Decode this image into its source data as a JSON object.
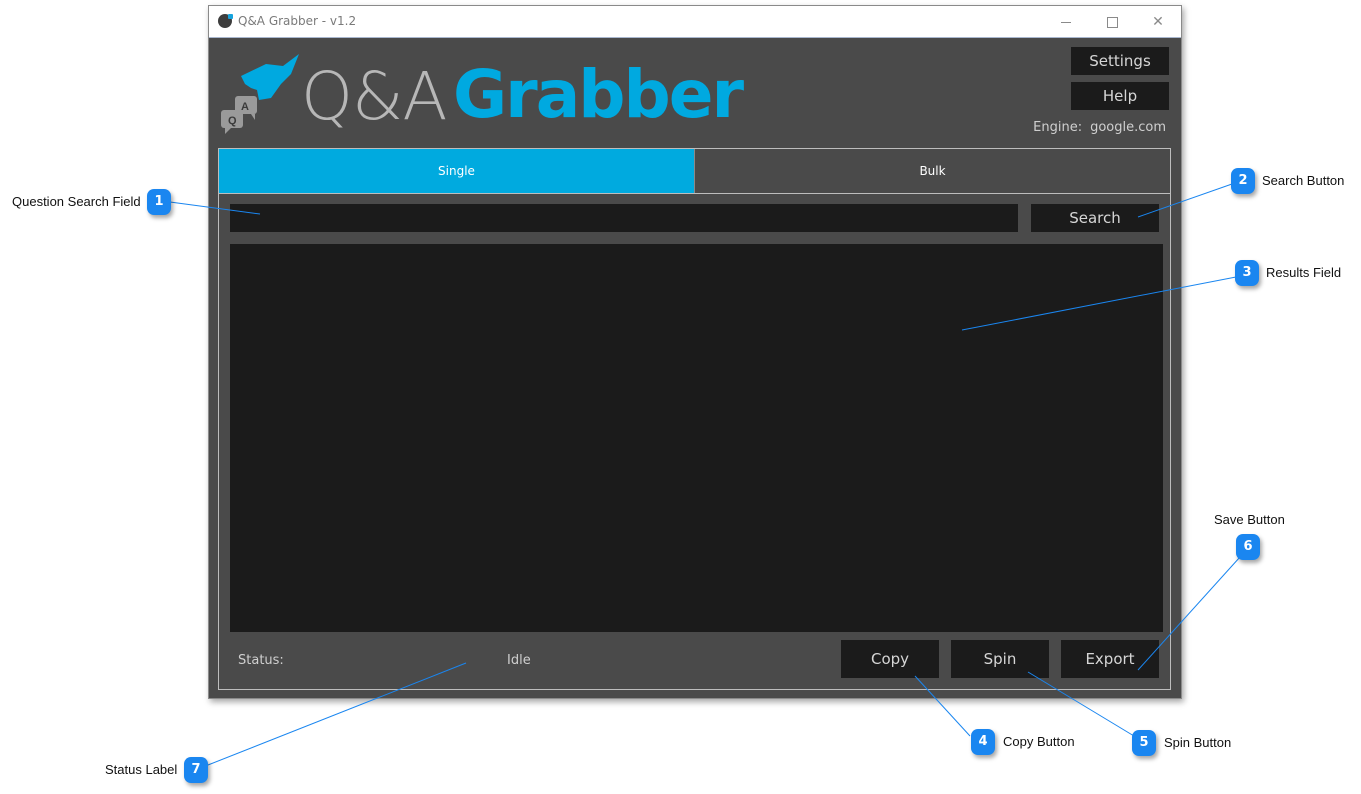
{
  "window": {
    "title": "Q&A Grabber - v1.2",
    "controls": {
      "minimize": "minimize",
      "maximize": "maximize",
      "close": "✕"
    }
  },
  "logo": {
    "part1": "Q&A",
    "part2": "Grabber",
    "badge_q": "Q",
    "badge_a": "A"
  },
  "header": {
    "settings_label": "Settings",
    "help_label": "Help",
    "engine_label": "Engine:",
    "engine_value": "google.com"
  },
  "tabs": [
    {
      "label": "Single",
      "active": true
    },
    {
      "label": "Bulk",
      "active": false
    }
  ],
  "search": {
    "value": "",
    "placeholder": "",
    "button_label": "Search"
  },
  "results": {
    "value": ""
  },
  "status": {
    "label": "Status:",
    "value": "Idle"
  },
  "actions": {
    "copy_label": "Copy",
    "spin_label": "Spin",
    "export_label": "Export"
  },
  "colors": {
    "accent": "#00aadf",
    "background": "#4a4a4a",
    "field": "#1b1b1b",
    "callout": "#1a86f0"
  },
  "callouts": [
    {
      "number": "1",
      "label": "Question Search Field"
    },
    {
      "number": "2",
      "label": "Search Button"
    },
    {
      "number": "3",
      "label": "Results Field"
    },
    {
      "number": "4",
      "label": "Copy Button"
    },
    {
      "number": "5",
      "label": "Spin Button"
    },
    {
      "number": "6",
      "label": "Save Button"
    },
    {
      "number": "7",
      "label": "Status Label"
    }
  ]
}
